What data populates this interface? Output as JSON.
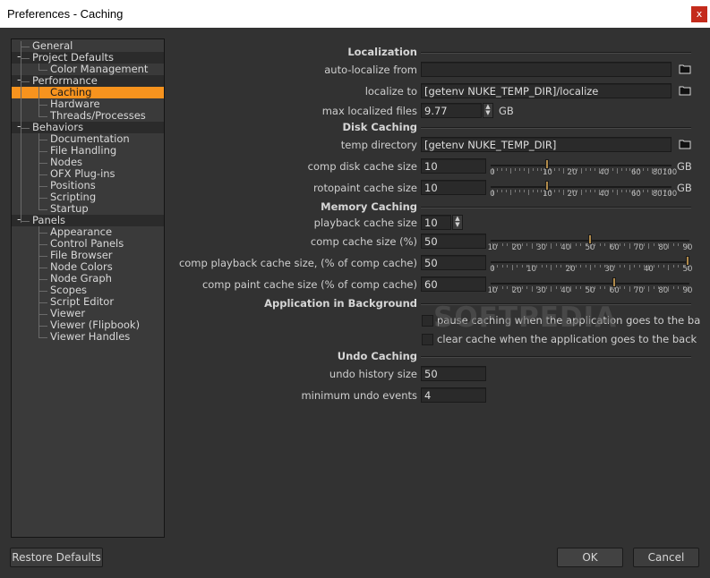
{
  "window": {
    "title": "Preferences - Caching",
    "close_glyph": "x"
  },
  "sidebar": {
    "items": [
      {
        "label": "General",
        "level": 0
      },
      {
        "label": "Project Defaults",
        "level": 0,
        "expander": "-"
      },
      {
        "label": "Color Management",
        "level": 1
      },
      {
        "label": "Performance",
        "level": 0,
        "expander": "-"
      },
      {
        "label": "Caching",
        "level": 1,
        "selected": true
      },
      {
        "label": "Hardware",
        "level": 1
      },
      {
        "label": "Threads/Processes",
        "level": 1
      },
      {
        "label": "Behaviors",
        "level": 0,
        "expander": "-"
      },
      {
        "label": "Documentation",
        "level": 1
      },
      {
        "label": "File Handling",
        "level": 1
      },
      {
        "label": "Nodes",
        "level": 1
      },
      {
        "label": "OFX Plug-ins",
        "level": 1
      },
      {
        "label": "Positions",
        "level": 1
      },
      {
        "label": "Scripting",
        "level": 1
      },
      {
        "label": "Startup",
        "level": 1
      },
      {
        "label": "Panels",
        "level": 0,
        "expander": "-"
      },
      {
        "label": "Appearance",
        "level": 1
      },
      {
        "label": "Control Panels",
        "level": 1
      },
      {
        "label": "File Browser",
        "level": 1
      },
      {
        "label": "Node Colors",
        "level": 1
      },
      {
        "label": "Node Graph",
        "level": 1
      },
      {
        "label": "Scopes",
        "level": 1
      },
      {
        "label": "Script Editor",
        "level": 1
      },
      {
        "label": "Viewer",
        "level": 1
      },
      {
        "label": "Viewer (Flipbook)",
        "level": 1
      },
      {
        "label": "Viewer Handles",
        "level": 1
      }
    ]
  },
  "localization": {
    "heading": "Localization",
    "auto_localize_label": "auto-localize from",
    "auto_localize_value": "",
    "localize_to_label": "localize to",
    "localize_to_value": "[getenv NUKE_TEMP_DIR]/localize",
    "max_files_label": "max localized files",
    "max_files_value": "9.77",
    "max_files_unit": "GB"
  },
  "disk_caching": {
    "heading": "Disk Caching",
    "temp_dir_label": "temp directory",
    "temp_dir_value": "[getenv NUKE_TEMP_DIR]",
    "comp_disk_label": "comp disk cache size",
    "comp_disk_value": "10",
    "comp_disk_unit": "GB",
    "comp_disk_ticks": [
      "0",
      "10",
      "20",
      "40",
      "60",
      "80",
      "100"
    ],
    "roto_label": "rotopaint cache size",
    "roto_value": "10",
    "roto_unit": "GB",
    "roto_ticks": [
      "0",
      "10",
      "20",
      "40",
      "60",
      "80",
      "100"
    ]
  },
  "memory_caching": {
    "heading": "Memory Caching",
    "playback_label": "playback cache size",
    "playback_value": "10",
    "comp_cache_label": "comp cache size (%)",
    "comp_cache_value": "50",
    "comp_cache_ticks": [
      "10",
      "20",
      "30",
      "40",
      "50",
      "60",
      "70",
      "80",
      "90"
    ],
    "comp_playback_label": "comp playback cache size, (% of comp cache)",
    "comp_playback_value": "50",
    "comp_playback_ticks": [
      "0",
      "10",
      "20",
      "30",
      "40",
      "50"
    ],
    "comp_paint_label": "comp paint cache size (% of comp cache)",
    "comp_paint_value": "60",
    "comp_paint_ticks": [
      "10",
      "20",
      "30",
      "40",
      "50",
      "60",
      "70",
      "80",
      "90"
    ]
  },
  "background": {
    "heading": "Application in Background",
    "pause_label": "pause caching when the application goes to the ba",
    "clear_label": "clear cache when the application goes to the back"
  },
  "undo": {
    "heading": "Undo Caching",
    "history_label": "undo history size",
    "history_value": "50",
    "min_events_label": "minimum undo events",
    "min_events_value": "4"
  },
  "footer": {
    "restore": "Restore Defaults",
    "ok": "OK",
    "cancel": "Cancel"
  },
  "watermark": "SOFTPEDIA",
  "colors": {
    "background": "#323232",
    "selection": "#f7931e",
    "close": "#c42b1c"
  },
  "icons": {
    "folder": "folder-icon",
    "spinner": "spinner-arrows-icon",
    "close": "close-icon"
  }
}
